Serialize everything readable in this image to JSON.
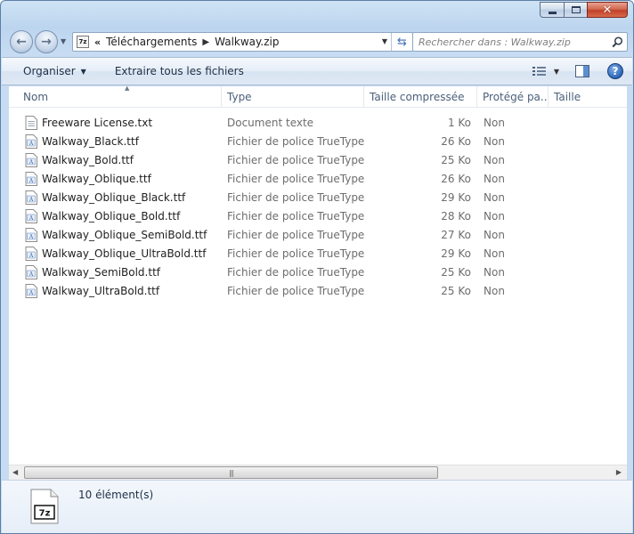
{
  "window": {
    "caption_min": "minimize",
    "caption_max": "maximize",
    "caption_close": "close"
  },
  "nav": {
    "breadcrumb_overflow": "«",
    "breadcrumb": [
      "Téléchargements",
      "Walkway.zip"
    ],
    "search_placeholder": "Rechercher dans : Walkway.zip"
  },
  "toolbar": {
    "organize_label": "Organiser",
    "extract_label": "Extraire tous les fichiers"
  },
  "columns": {
    "name": "Nom",
    "type": "Type",
    "compressed_size": "Taille compressée",
    "protected": "Protégé pa...",
    "size": "Taille"
  },
  "files": [
    {
      "name": "Freeware License.txt",
      "type": "Document texte",
      "size": "1 Ko",
      "protected": "Non",
      "icon": "text-file-icon"
    },
    {
      "name": "Walkway_Black.ttf",
      "type": "Fichier de police TrueType",
      "size": "26 Ko",
      "protected": "Non",
      "icon": "font-file-icon"
    },
    {
      "name": "Walkway_Bold.ttf",
      "type": "Fichier de police TrueType",
      "size": "25 Ko",
      "protected": "Non",
      "icon": "font-file-icon"
    },
    {
      "name": "Walkway_Oblique.ttf",
      "type": "Fichier de police TrueType",
      "size": "26 Ko",
      "protected": "Non",
      "icon": "font-file-icon"
    },
    {
      "name": "Walkway_Oblique_Black.ttf",
      "type": "Fichier de police TrueType",
      "size": "29 Ko",
      "protected": "Non",
      "icon": "font-file-icon"
    },
    {
      "name": "Walkway_Oblique_Bold.ttf",
      "type": "Fichier de police TrueType",
      "size": "28 Ko",
      "protected": "Non",
      "icon": "font-file-icon"
    },
    {
      "name": "Walkway_Oblique_SemiBold.ttf",
      "type": "Fichier de police TrueType",
      "size": "27 Ko",
      "protected": "Non",
      "icon": "font-file-icon"
    },
    {
      "name": "Walkway_Oblique_UltraBold.ttf",
      "type": "Fichier de police TrueType",
      "size": "29 Ko",
      "protected": "Non",
      "icon": "font-file-icon"
    },
    {
      "name": "Walkway_SemiBold.ttf",
      "type": "Fichier de police TrueType",
      "size": "25 Ko",
      "protected": "Non",
      "icon": "font-file-icon"
    },
    {
      "name": "Walkway_UltraBold.ttf",
      "type": "Fichier de police TrueType",
      "size": "25 Ko",
      "protected": "Non",
      "icon": "font-file-icon"
    }
  ],
  "status": {
    "item_count": "10 élément(s)",
    "icon_label": "7z"
  },
  "colors": {
    "accent": "#2e66b5",
    "secondary_text": "#6d6d6d",
    "close_button": "#c0412a"
  }
}
